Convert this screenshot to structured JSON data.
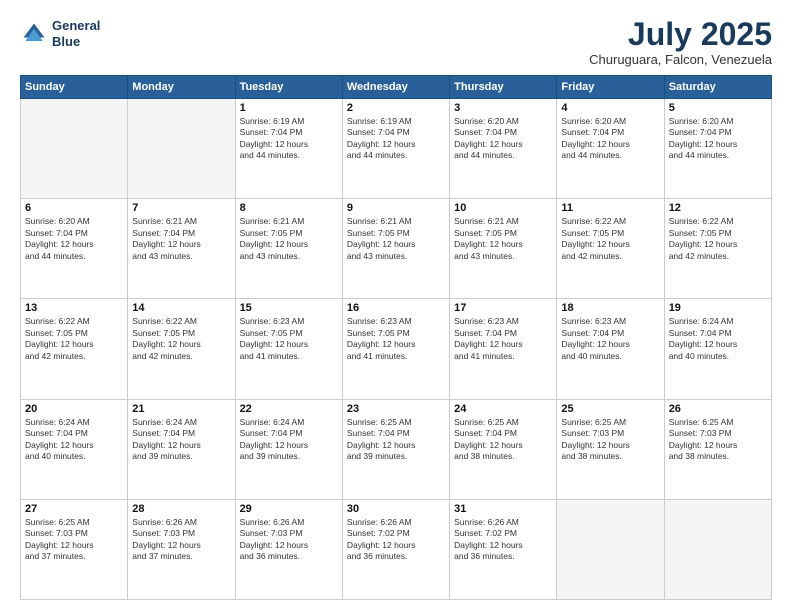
{
  "header": {
    "logo_line1": "General",
    "logo_line2": "Blue",
    "month": "July 2025",
    "location": "Churuguara, Falcon, Venezuela"
  },
  "weekdays": [
    "Sunday",
    "Monday",
    "Tuesday",
    "Wednesday",
    "Thursday",
    "Friday",
    "Saturday"
  ],
  "weeks": [
    [
      {
        "day": "",
        "text": ""
      },
      {
        "day": "",
        "text": ""
      },
      {
        "day": "1",
        "text": "Sunrise: 6:19 AM\nSunset: 7:04 PM\nDaylight: 12 hours\nand 44 minutes."
      },
      {
        "day": "2",
        "text": "Sunrise: 6:19 AM\nSunset: 7:04 PM\nDaylight: 12 hours\nand 44 minutes."
      },
      {
        "day": "3",
        "text": "Sunrise: 6:20 AM\nSunset: 7:04 PM\nDaylight: 12 hours\nand 44 minutes."
      },
      {
        "day": "4",
        "text": "Sunrise: 6:20 AM\nSunset: 7:04 PM\nDaylight: 12 hours\nand 44 minutes."
      },
      {
        "day": "5",
        "text": "Sunrise: 6:20 AM\nSunset: 7:04 PM\nDaylight: 12 hours\nand 44 minutes."
      }
    ],
    [
      {
        "day": "6",
        "text": "Sunrise: 6:20 AM\nSunset: 7:04 PM\nDaylight: 12 hours\nand 44 minutes."
      },
      {
        "day": "7",
        "text": "Sunrise: 6:21 AM\nSunset: 7:04 PM\nDaylight: 12 hours\nand 43 minutes."
      },
      {
        "day": "8",
        "text": "Sunrise: 6:21 AM\nSunset: 7:05 PM\nDaylight: 12 hours\nand 43 minutes."
      },
      {
        "day": "9",
        "text": "Sunrise: 6:21 AM\nSunset: 7:05 PM\nDaylight: 12 hours\nand 43 minutes."
      },
      {
        "day": "10",
        "text": "Sunrise: 6:21 AM\nSunset: 7:05 PM\nDaylight: 12 hours\nand 43 minutes."
      },
      {
        "day": "11",
        "text": "Sunrise: 6:22 AM\nSunset: 7:05 PM\nDaylight: 12 hours\nand 42 minutes."
      },
      {
        "day": "12",
        "text": "Sunrise: 6:22 AM\nSunset: 7:05 PM\nDaylight: 12 hours\nand 42 minutes."
      }
    ],
    [
      {
        "day": "13",
        "text": "Sunrise: 6:22 AM\nSunset: 7:05 PM\nDaylight: 12 hours\nand 42 minutes."
      },
      {
        "day": "14",
        "text": "Sunrise: 6:22 AM\nSunset: 7:05 PM\nDaylight: 12 hours\nand 42 minutes."
      },
      {
        "day": "15",
        "text": "Sunrise: 6:23 AM\nSunset: 7:05 PM\nDaylight: 12 hours\nand 41 minutes."
      },
      {
        "day": "16",
        "text": "Sunrise: 6:23 AM\nSunset: 7:05 PM\nDaylight: 12 hours\nand 41 minutes."
      },
      {
        "day": "17",
        "text": "Sunrise: 6:23 AM\nSunset: 7:04 PM\nDaylight: 12 hours\nand 41 minutes."
      },
      {
        "day": "18",
        "text": "Sunrise: 6:23 AM\nSunset: 7:04 PM\nDaylight: 12 hours\nand 40 minutes."
      },
      {
        "day": "19",
        "text": "Sunrise: 6:24 AM\nSunset: 7:04 PM\nDaylight: 12 hours\nand 40 minutes."
      }
    ],
    [
      {
        "day": "20",
        "text": "Sunrise: 6:24 AM\nSunset: 7:04 PM\nDaylight: 12 hours\nand 40 minutes."
      },
      {
        "day": "21",
        "text": "Sunrise: 6:24 AM\nSunset: 7:04 PM\nDaylight: 12 hours\nand 39 minutes."
      },
      {
        "day": "22",
        "text": "Sunrise: 6:24 AM\nSunset: 7:04 PM\nDaylight: 12 hours\nand 39 minutes."
      },
      {
        "day": "23",
        "text": "Sunrise: 6:25 AM\nSunset: 7:04 PM\nDaylight: 12 hours\nand 39 minutes."
      },
      {
        "day": "24",
        "text": "Sunrise: 6:25 AM\nSunset: 7:04 PM\nDaylight: 12 hours\nand 38 minutes."
      },
      {
        "day": "25",
        "text": "Sunrise: 6:25 AM\nSunset: 7:03 PM\nDaylight: 12 hours\nand 38 minutes."
      },
      {
        "day": "26",
        "text": "Sunrise: 6:25 AM\nSunset: 7:03 PM\nDaylight: 12 hours\nand 38 minutes."
      }
    ],
    [
      {
        "day": "27",
        "text": "Sunrise: 6:25 AM\nSunset: 7:03 PM\nDaylight: 12 hours\nand 37 minutes."
      },
      {
        "day": "28",
        "text": "Sunrise: 6:26 AM\nSunset: 7:03 PM\nDaylight: 12 hours\nand 37 minutes."
      },
      {
        "day": "29",
        "text": "Sunrise: 6:26 AM\nSunset: 7:03 PM\nDaylight: 12 hours\nand 36 minutes."
      },
      {
        "day": "30",
        "text": "Sunrise: 6:26 AM\nSunset: 7:02 PM\nDaylight: 12 hours\nand 36 minutes."
      },
      {
        "day": "31",
        "text": "Sunrise: 6:26 AM\nSunset: 7:02 PM\nDaylight: 12 hours\nand 36 minutes."
      },
      {
        "day": "",
        "text": ""
      },
      {
        "day": "",
        "text": ""
      }
    ]
  ]
}
